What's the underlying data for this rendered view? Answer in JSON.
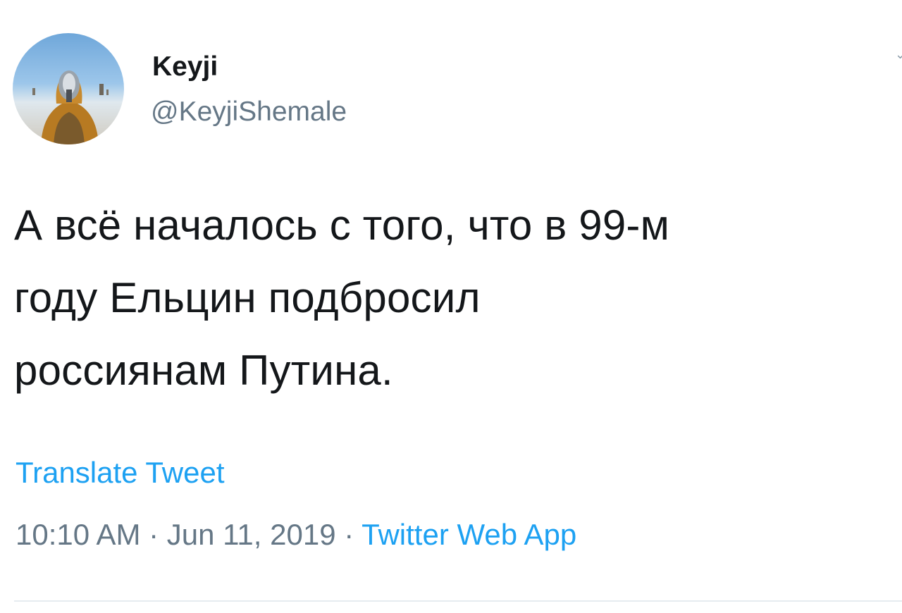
{
  "tweet": {
    "author": {
      "display_name": "Keyji",
      "handle": "@KeyjiShemale",
      "avatar_icon": "profile-photo"
    },
    "text_lines": [
      "А всё началось с того, что в 99-м",
      "году Ельцин подбросил",
      "россиянам Путина."
    ],
    "translate_label": "Translate Tweet",
    "time": "10:10 AM",
    "separator": " · ",
    "date": "Jun 11, 2019",
    "source": "Twitter Web App",
    "caret_icon": "chevron-down-icon"
  },
  "colors": {
    "text": "#14171a",
    "secondary": "#657786",
    "link": "#1da1f2",
    "divider": "#e6ecf0"
  }
}
